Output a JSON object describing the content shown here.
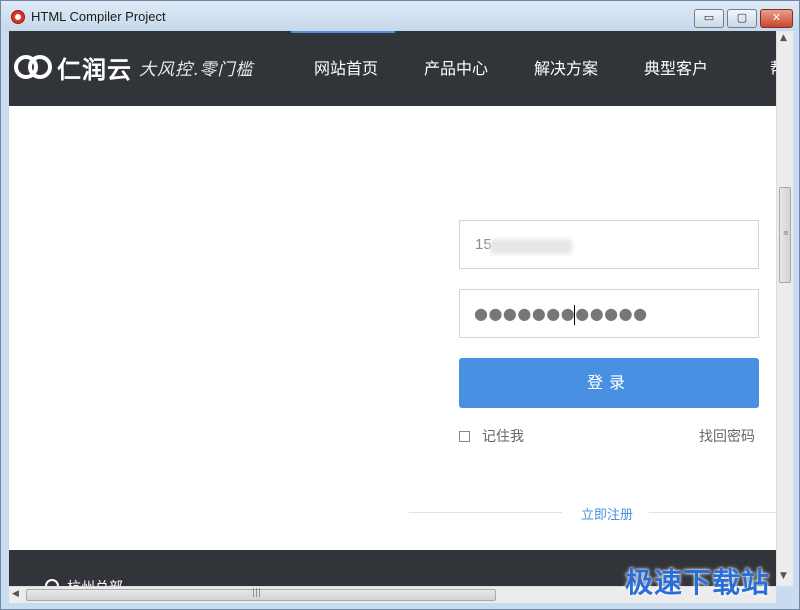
{
  "window": {
    "title": "HTML Compiler Project",
    "controls": {
      "minimize": "▭",
      "maximize": "▢",
      "close": "✕"
    }
  },
  "header": {
    "logo_text": "仁润云",
    "slogan": "大风控.零门槛",
    "nav": [
      {
        "label": "网站首页",
        "active": true
      },
      {
        "label": "产品中心",
        "active": false
      },
      {
        "label": "解决方案",
        "active": false
      },
      {
        "label": "典型客户",
        "active": false
      },
      {
        "label": "帮助",
        "active": false
      }
    ]
  },
  "login": {
    "phone_value": "15",
    "password_mask": "●●●●●●●●●●●●",
    "submit_label": "登录",
    "remember_label": "记住我",
    "remember_checked": false,
    "forgot_label": "找回密码",
    "register_label": "立即注册"
  },
  "footer": {
    "text": "杭州总部"
  },
  "watermark": "极速下载站",
  "colors": {
    "header_bg": "#313439",
    "accent": "#4a90e2",
    "titlebar": "#c6d8ec",
    "close_button": "#c8452c"
  },
  "icons": {
    "app": "app-icon",
    "logo": "logo-link-icon",
    "checkbox": "checkbox-icon",
    "footer": "location-icon"
  }
}
